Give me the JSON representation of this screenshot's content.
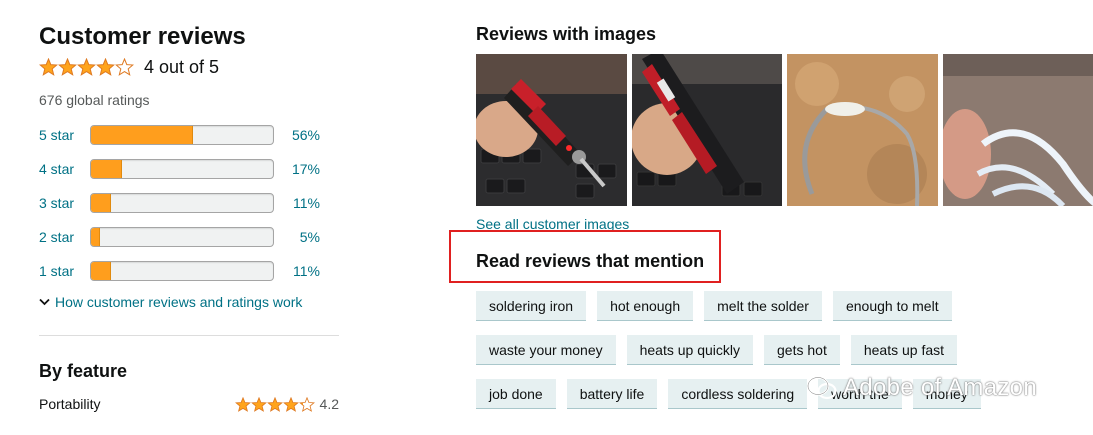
{
  "reviews": {
    "title": "Customer reviews",
    "rating_value": 4,
    "rating_max": 5,
    "rating_text": "4 out of 5",
    "global_ratings": "676 global ratings",
    "histogram": [
      {
        "label": "5 star",
        "pct_text": "56%",
        "pct": 56
      },
      {
        "label": "4 star",
        "pct_text": "17%",
        "pct": 17
      },
      {
        "label": "3 star",
        "pct_text": "11%",
        "pct": 11
      },
      {
        "label": "2 star",
        "pct_text": "5%",
        "pct": 5
      },
      {
        "label": "1 star",
        "pct_text": "11%",
        "pct": 11
      }
    ],
    "how_link": "How customer reviews and ratings work"
  },
  "feature": {
    "title": "By feature",
    "items": [
      {
        "name": "Portability",
        "rating": 4.2,
        "rating_text": "4.2"
      }
    ]
  },
  "images": {
    "title": "Reviews with images",
    "thumbnails": [
      "soldering-iron-on-keyboard",
      "cordless-soldering-iron-in-hand",
      "soldered-wire-on-gold-surface",
      "white-cable-coil"
    ],
    "see_all": "See all customer images"
  },
  "mention": {
    "title": "Read reviews that mention",
    "rows": [
      [
        "soldering iron",
        "hot enough",
        "melt the solder",
        "enough to melt"
      ],
      [
        "waste your money",
        "heats up quickly",
        "gets hot",
        "heats up fast"
      ],
      [
        "job done",
        "battery life",
        "cordless soldering",
        "worth the",
        "money"
      ]
    ]
  },
  "watermark": {
    "text": "Adobe of Amazon"
  },
  "colors": {
    "star": "#ffa41c",
    "link": "#007185",
    "bar_fill": "#ff9e1d",
    "chip_bg": "#e6f0f1",
    "highlight_box": "#e02020"
  }
}
